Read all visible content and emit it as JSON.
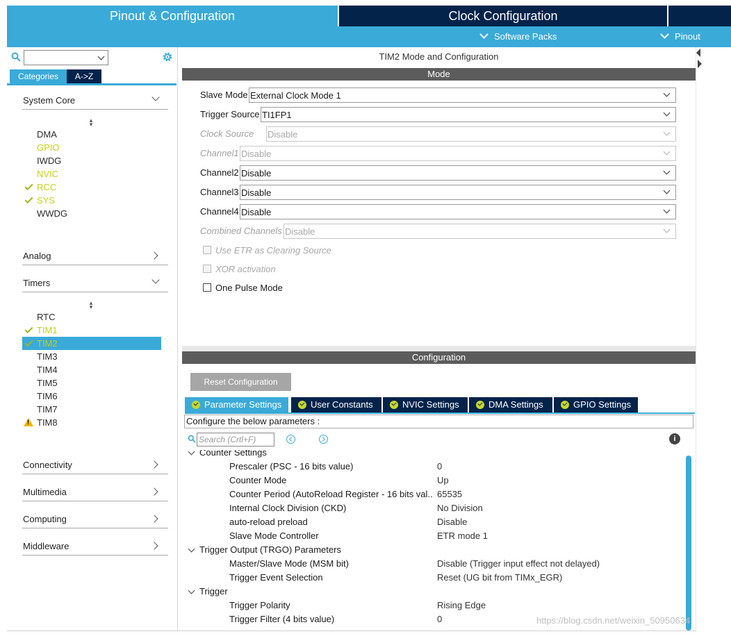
{
  "header": {
    "tab_pinout": "Pinout & Configuration",
    "tab_clock": "Clock Configuration",
    "software_packs": "Software Packs",
    "pinout": "Pinout"
  },
  "colors": {
    "accent": "#3aaad8",
    "navy": "#03234b",
    "ok": "#c8cf1a",
    "bar": "#5c5c5c"
  },
  "left": {
    "search_value": "",
    "tabs": {
      "categories": "Categories",
      "az": "A->Z"
    },
    "system_core": {
      "label": "System Core",
      "items": [
        {
          "label": "DMA",
          "status": "none"
        },
        {
          "label": "GPIO",
          "status": "configured"
        },
        {
          "label": "IWDG",
          "status": "none"
        },
        {
          "label": "NVIC",
          "status": "configured"
        },
        {
          "label": "RCC",
          "status": "ok"
        },
        {
          "label": "SYS",
          "status": "ok"
        },
        {
          "label": "WWDG",
          "status": "none"
        }
      ]
    },
    "analog": "Analog",
    "timers": {
      "label": "Timers",
      "items": [
        {
          "label": "RTC",
          "status": "none"
        },
        {
          "label": "TIM1",
          "status": "ok"
        },
        {
          "label": "TIM2",
          "status": "ok",
          "selected": true
        },
        {
          "label": "TIM3",
          "status": "none"
        },
        {
          "label": "TIM4",
          "status": "none"
        },
        {
          "label": "TIM5",
          "status": "none"
        },
        {
          "label": "TIM6",
          "status": "none"
        },
        {
          "label": "TIM7",
          "status": "none"
        },
        {
          "label": "TIM8",
          "status": "warning"
        }
      ]
    },
    "connectivity": "Connectivity",
    "multimedia": "Multimedia",
    "computing": "Computing",
    "middleware": "Middleware"
  },
  "mode": {
    "title": "TIM2 Mode and Configuration",
    "bar": "Mode",
    "fields": {
      "slave_mode": {
        "label": "Slave Mode",
        "value": "External Clock Mode 1"
      },
      "trigger_source": {
        "label": "Trigger Source",
        "value": "TI1FP1"
      },
      "clock_source": {
        "label": "Clock Source",
        "value": "Disable"
      },
      "channel1": {
        "label": "Channel1",
        "value": "Disable"
      },
      "channel2": {
        "label": "Channel2",
        "value": "Disable"
      },
      "channel3": {
        "label": "Channel3",
        "value": "Disable"
      },
      "channel4": {
        "label": "Channel4",
        "value": "Disable"
      },
      "combined": {
        "label": "Combined Channels",
        "value": "Disable"
      }
    },
    "checkboxes": {
      "etr": "Use ETR as Clearing Source",
      "xor": "XOR activation",
      "one_pulse": "One Pulse Mode"
    }
  },
  "config": {
    "bar": "Configuration",
    "reset": "Reset Configuration",
    "tabs": {
      "params": "Parameter Settings",
      "user": "User Constants",
      "nvic": "NVIC Settings",
      "dma": "DMA Settings",
      "gpio": "GPIO Settings"
    },
    "hint": "Configure the below parameters :",
    "search_placeholder": "Search (Crtl+F)",
    "info": "i",
    "groups": {
      "counter": "Counter Settings",
      "trgo": "Trigger Output (TRGO) Parameters",
      "trigger": "Trigger"
    },
    "params": {
      "prescaler": {
        "label": "Prescaler (PSC - 16 bits value)",
        "value": "0"
      },
      "counter_mode": {
        "label": "Counter Mode",
        "value": "Up"
      },
      "period": {
        "label": "Counter Period (AutoReload Register - 16 bits val...",
        "value": "65535"
      },
      "ckd": {
        "label": "Internal Clock Division (CKD)",
        "value": "No Division"
      },
      "arpe": {
        "label": "auto-reload preload",
        "value": "Disable"
      },
      "smc": {
        "label": "Slave Mode Controller",
        "value": "ETR mode 1"
      },
      "msm": {
        "label": "Master/Slave Mode (MSM bit)",
        "value": "Disable (Trigger input effect not delayed)"
      },
      "tes": {
        "label": "Trigger Event Selection",
        "value": "Reset (UG bit from TIMx_EGR)"
      },
      "polarity": {
        "label": "Trigger Polarity",
        "value": "Rising Edge"
      },
      "filter": {
        "label": "Trigger Filter (4 bits value)",
        "value": "0"
      }
    }
  },
  "watermark": "https://blog.csdn.net/weixin_50950634"
}
